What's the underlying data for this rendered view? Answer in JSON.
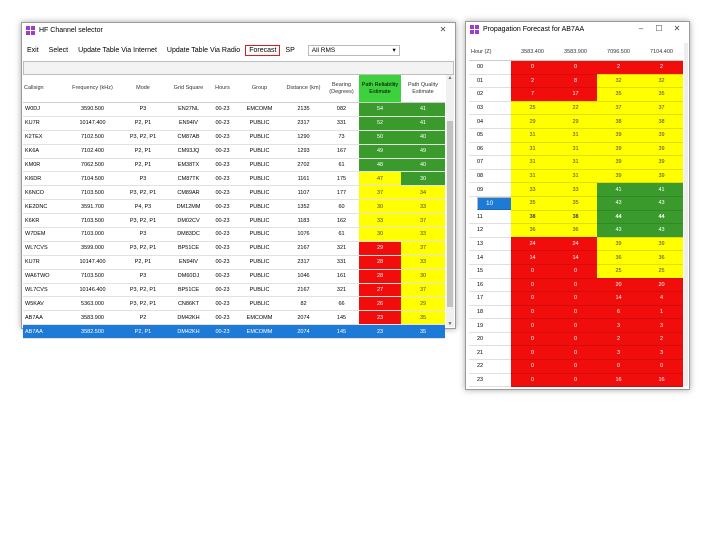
{
  "selector": {
    "title": "HF Channel selector",
    "menu": [
      "Exit",
      "Select",
      "Update Table Via Internet",
      "Update Table Via Radio",
      "Forecast"
    ],
    "sp_label": "SP",
    "sp_value": "All RMS",
    "columns": [
      "Callsign",
      "Frequency (kHz)",
      "Mode",
      "Grid Square",
      "Hours",
      "Group",
      "Distance (km)",
      "Bearing (Degrees)",
      "Path Reliability Estimate",
      "Path Quality Estimate"
    ],
    "rows": [
      [
        "W0DJ",
        "3590.500",
        "P3",
        "EN27NL",
        "00-23",
        "EMCOMM",
        "2135",
        "082",
        "54",
        "41"
      ],
      [
        "KU7R",
        "10147.400",
        "P2, P1",
        "EN94IV",
        "00-23",
        "PUBLIC",
        "2317",
        "331",
        "52",
        "41"
      ],
      [
        "K2TEX",
        "7102.500",
        "P3, P2, P1",
        "CM87AB",
        "00-23",
        "PUBLIC",
        "1290",
        "73",
        "50",
        "40"
      ],
      [
        "KK6A",
        "7102.400",
        "P2, P1",
        "CM93JQ",
        "00-23",
        "PUBLIC",
        "1293",
        "167",
        "49",
        "49"
      ],
      [
        "KM0R",
        "7062.500",
        "P2, P1",
        "EM38TX",
        "00-23",
        "PUBLIC",
        "2702",
        "61",
        "48",
        "40"
      ],
      [
        "KI6DR",
        "7104.500",
        "P3",
        "CM87TK",
        "00-23",
        "PUBLIC",
        "1161",
        "175",
        "47",
        "30"
      ],
      [
        "K6NCO",
        "7103.500",
        "P3, P2, P1",
        "CM89AR",
        "00-23",
        "PUBLIC",
        "1107",
        "177",
        "37",
        "34"
      ],
      [
        "KE2DNC",
        "3591.700",
        "P4, P3",
        "DM12MM",
        "00-23",
        "PUBLIC",
        "1352",
        "60",
        "30",
        "33"
      ],
      [
        "K6KR",
        "7103.500",
        "P3, P2, P1",
        "DM02CV",
        "00-23",
        "PUBLIC",
        "1183",
        "162",
        "33",
        "37"
      ],
      [
        "W7DEM",
        "7103.000",
        "P3",
        "DM83DC",
        "00-23",
        "PUBLIC",
        "1076",
        "61",
        "30",
        "33"
      ],
      [
        "WL7CVS",
        "3599.000",
        "P3, P2, P1",
        "BP51CE",
        "00-23",
        "PUBLIC",
        "2167",
        "321",
        "29",
        "37"
      ],
      [
        "KU7R",
        "10147.400",
        "P2, P1",
        "EN94IV",
        "00-23",
        "PUBLIC",
        "2317",
        "331",
        "28",
        "33"
      ],
      [
        "WA6TWO",
        "7103.500",
        "P3",
        "DM60DJ",
        "00-23",
        "PUBLIC",
        "1046",
        "161",
        "28",
        "30"
      ],
      [
        "WL7CVS",
        "10146.400",
        "P3, P2, P1",
        "BP51CE",
        "00-23",
        "PUBLIC",
        "2167",
        "321",
        "27",
        "37"
      ],
      [
        "W5KAV",
        "5363.000",
        "P3, P2, P1",
        "CN86KT",
        "00-23",
        "PUBLIC",
        "82",
        "66",
        "26",
        "29"
      ],
      [
        "AB7AA",
        "3583.900",
        "P2",
        "DM42KH",
        "00-23",
        "EMCOMM",
        "2074",
        "145",
        "23",
        "35"
      ],
      [
        "AB7AA",
        "3582.500",
        "P2, P1",
        "DM42KH",
        "00-23",
        "EMCOMM",
        "2074",
        "145",
        "23",
        "35"
      ]
    ],
    "cell_colors": [
      [
        "g",
        "g"
      ],
      [
        "g",
        "g"
      ],
      [
        "g",
        "g"
      ],
      [
        "g",
        "g"
      ],
      [
        "g",
        "g"
      ],
      [
        "y",
        "g"
      ],
      [
        "y",
        "y"
      ],
      [
        "y",
        "y"
      ],
      [
        "y",
        "y"
      ],
      [
        "y",
        "y"
      ],
      [
        "r",
        "y"
      ],
      [
        "r",
        "y"
      ],
      [
        "r",
        "y"
      ],
      [
        "r",
        "y"
      ],
      [
        "r",
        "y"
      ],
      [
        "r",
        "y"
      ],
      [
        "r",
        "y"
      ]
    ],
    "selected_row": 16
  },
  "forecast": {
    "title": "Propagation Forecast for AB7AA",
    "columns": [
      "Hour (Z)",
      "3583.400",
      "3583.900",
      "7096.500",
      "7104.400"
    ],
    "rows": [
      [
        "00",
        "0",
        "0",
        "2",
        "2"
      ],
      [
        "01",
        "2",
        "8",
        "32",
        "32"
      ],
      [
        "02",
        "7",
        "17",
        "35",
        "35"
      ],
      [
        "03",
        "25",
        "22",
        "37",
        "37"
      ],
      [
        "04",
        "29",
        "29",
        "38",
        "38"
      ],
      [
        "05",
        "31",
        "31",
        "39",
        "39"
      ],
      [
        "06",
        "31",
        "31",
        "39",
        "39"
      ],
      [
        "07",
        "31",
        "31",
        "39",
        "39"
      ],
      [
        "08",
        "31",
        "31",
        "39",
        "39"
      ],
      [
        "09",
        "33",
        "33",
        "41",
        "41"
      ],
      [
        "10",
        "35",
        "35",
        "43",
        "43"
      ],
      [
        "11",
        "38",
        "38",
        "44",
        "44"
      ],
      [
        "12",
        "36",
        "36",
        "43",
        "43"
      ],
      [
        "13",
        "24",
        "24",
        "39",
        "39"
      ],
      [
        "14",
        "14",
        "14",
        "36",
        "36"
      ],
      [
        "15",
        "0",
        "0",
        "25",
        "25"
      ],
      [
        "16",
        "0",
        "0",
        "20",
        "20"
      ],
      [
        "17",
        "0",
        "0",
        "14",
        "4"
      ],
      [
        "18",
        "0",
        "0",
        "6",
        "1"
      ],
      [
        "19",
        "0",
        "0",
        "3",
        "3"
      ],
      [
        "20",
        "0",
        "0",
        "2",
        "2"
      ],
      [
        "21",
        "0",
        "0",
        "3",
        "3"
      ],
      [
        "22",
        "0",
        "0",
        "0",
        "0"
      ],
      [
        "23",
        "0",
        "0",
        "16",
        "16"
      ]
    ],
    "cell_colors": [
      [
        "r",
        "r",
        "r",
        "r"
      ],
      [
        "r",
        "r",
        "y",
        "y"
      ],
      [
        "r",
        "r",
        "y",
        "y"
      ],
      [
        "y",
        "y",
        "y",
        "y"
      ],
      [
        "y",
        "y",
        "y",
        "y"
      ],
      [
        "y",
        "y",
        "y",
        "y"
      ],
      [
        "y",
        "y",
        "y",
        "y"
      ],
      [
        "y",
        "y",
        "y",
        "y"
      ],
      [
        "y",
        "y",
        "y",
        "y"
      ],
      [
        "y",
        "y",
        "g",
        "g"
      ],
      [
        "y",
        "y",
        "g",
        "g"
      ],
      [
        "y",
        "y",
        "g",
        "g"
      ],
      [
        "y",
        "y",
        "g",
        "g"
      ],
      [
        "r",
        "r",
        "y",
        "y"
      ],
      [
        "r",
        "r",
        "y",
        "y"
      ],
      [
        "r",
        "r",
        "y",
        "y"
      ],
      [
        "r",
        "r",
        "r",
        "r"
      ],
      [
        "r",
        "r",
        "r",
        "r"
      ],
      [
        "r",
        "r",
        "r",
        "r"
      ],
      [
        "r",
        "r",
        "r",
        "r"
      ],
      [
        "r",
        "r",
        "r",
        "r"
      ],
      [
        "r",
        "r",
        "r",
        "r"
      ],
      [
        "r",
        "r",
        "r",
        "r"
      ],
      [
        "r",
        "r",
        "r",
        "r"
      ]
    ],
    "bold_rows": [
      11
    ],
    "selected_hour": 10
  }
}
